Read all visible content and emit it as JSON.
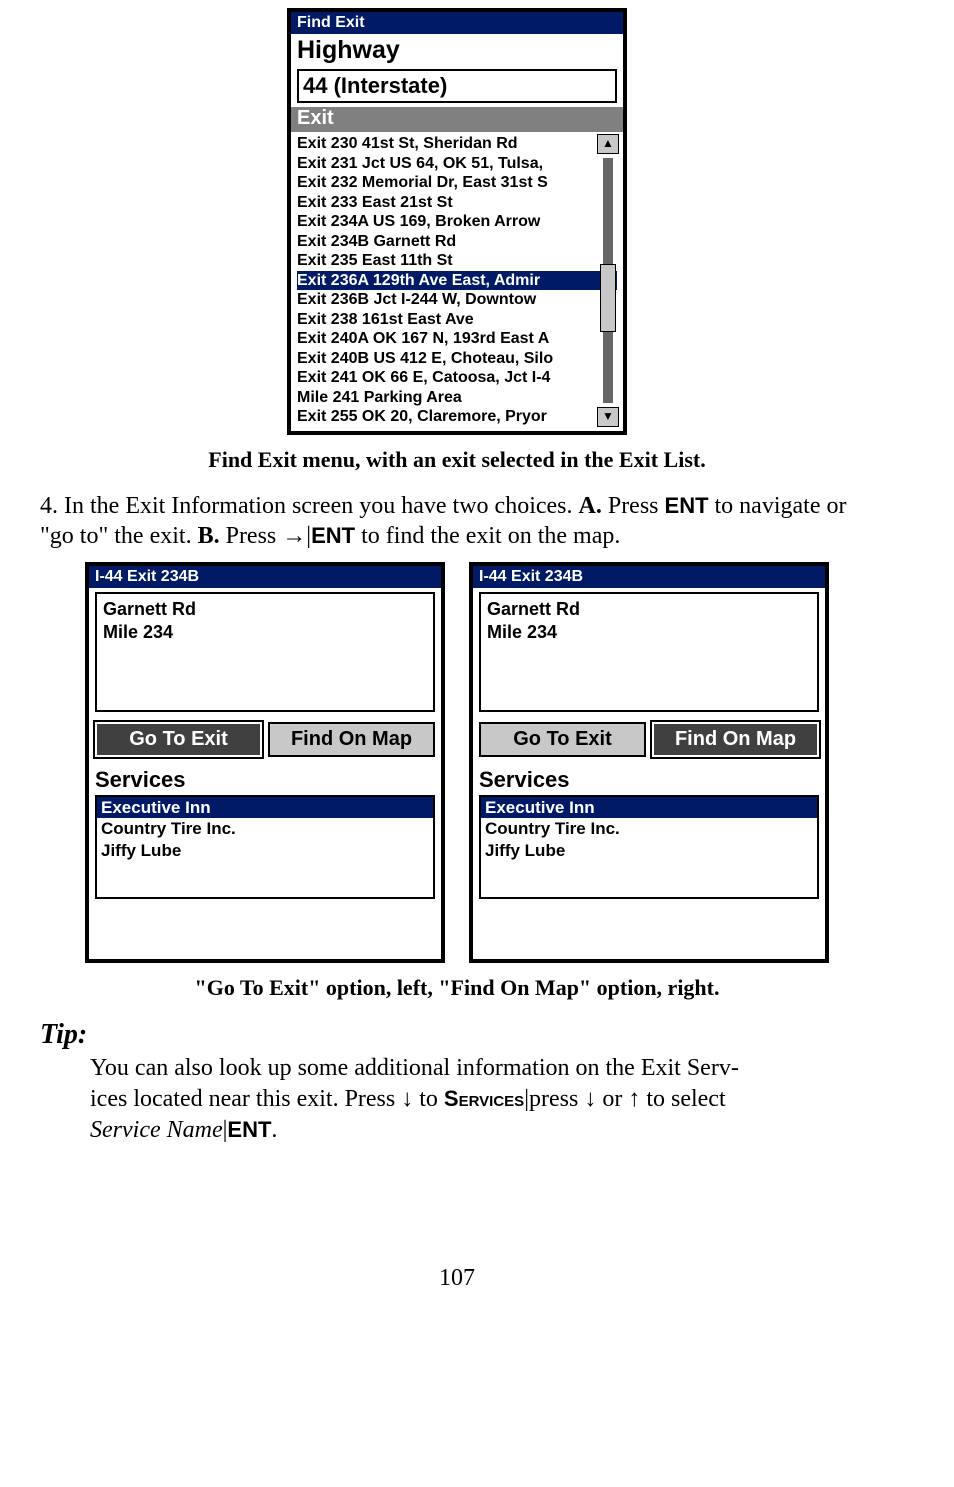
{
  "find_exit": {
    "title": "Find Exit",
    "highway_label": "Highway",
    "highway_value": "44 (Interstate)",
    "exit_label": "Exit",
    "items": [
      "Exit 230 41st St, Sheridan Rd",
      "Exit 231 Jct US 64, OK 51, Tulsa,",
      "Exit 232 Memorial Dr, East 31st S",
      "Exit 233 East 21st St",
      "Exit 234A US 169, Broken Arrow",
      "Exit 234B Garnett Rd",
      "Exit 235 East 11th St",
      "Exit 236A 129th Ave East, Admir",
      "Exit 236B Jct I-244 W, Downtow",
      "Exit 238 161st East Ave",
      "Exit 240A OK 167 N, 193rd East A",
      "Exit 240B US 412 E, Choteau, Silo",
      "Exit 241 OK 66 E, Catoosa, Jct I-4",
      "Mile 241 Parking Area",
      "Exit 255 OK 20, Claremore, Pryor"
    ],
    "selected_index": 7,
    "scroll_up": "▲",
    "scroll_down": "▼"
  },
  "caption1": "Find Exit menu, with an exit selected in the Exit List.",
  "step4": {
    "prefix": "4. In the Exit Information screen you have two choices. ",
    "a_label": "A.",
    "a_text": " Press ",
    "ent": "ENT",
    "a_tail": " to navigate or \"go to\" the exit. ",
    "b_label": "B.",
    "b_text": " Press ",
    "arrow": "→",
    "sep": "|",
    "b_tail": " to find the exit on the map."
  },
  "exit_info_left": {
    "title": "I-44 Exit 234B",
    "line1": "Garnett Rd",
    "line2": "Mile 234",
    "btn_go": "Go To Exit",
    "btn_find": "Find On Map",
    "active": "go",
    "services_label": "Services",
    "services": [
      "Executive Inn",
      "Country Tire Inc.",
      "Jiffy Lube"
    ],
    "svc_selected": 0
  },
  "exit_info_right": {
    "title": "I-44 Exit 234B",
    "line1": "Garnett Rd",
    "line2": "Mile 234",
    "btn_go": "Go To Exit",
    "btn_find": "Find On Map",
    "active": "find",
    "services_label": "Services",
    "services": [
      "Executive Inn",
      "Country Tire Inc.",
      "Jiffy Lube"
    ],
    "svc_selected": 0
  },
  "caption2": "\"Go To Exit\" option, left, \"Find On Map\" option, right.",
  "tip": {
    "heading": "Tip:",
    "line1a": "You can also look up some additional information on the Exit Serv-",
    "line2a": "ices located near this exit. Press ",
    "down": "↓",
    "to": " to ",
    "services": "Services",
    "sep": "|",
    "press": "press ",
    "or": " or ",
    "up": "↑",
    "tosel": " to select",
    "svcname": "Service Name",
    "ent": "ENT",
    "period": "."
  },
  "page_number": "107"
}
